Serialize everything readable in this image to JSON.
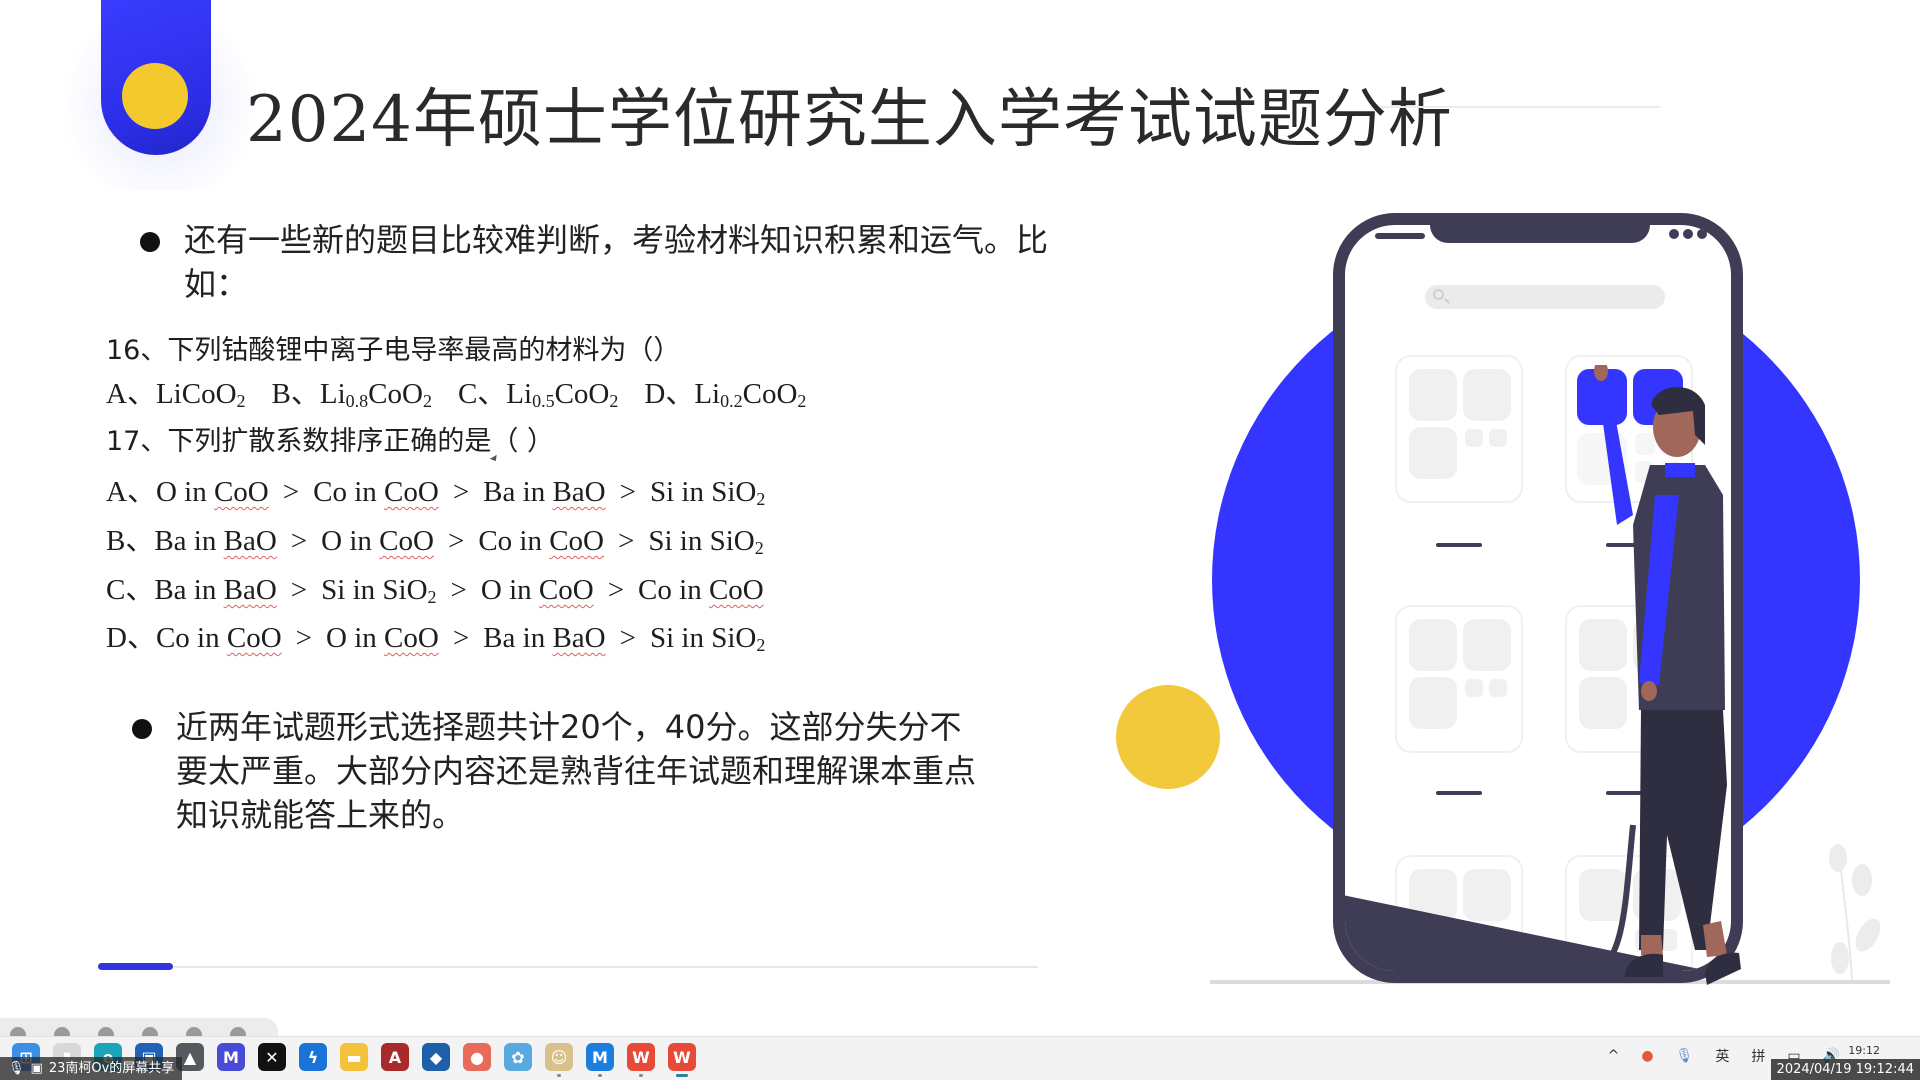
{
  "slide": {
    "title": "2024年硕士学位研究生入学考试试题分析",
    "bullet1": "还有一些新的题目比较难判断，考验材料知识积累和运气。比如：",
    "q16": {
      "stem": "16、下列钴酸锂中离子电导率最高的材料为（）",
      "options": [
        {
          "label": "A、",
          "formula": "LiCoO",
          "sub1": "",
          "mid": "",
          "sub2": "2",
          "pre": "Li",
          "x": ""
        },
        {
          "label": "B、",
          "pre": "Li",
          "x": "0.8",
          "formula": "CoO",
          "sub2": "2"
        },
        {
          "label": "C、",
          "pre": "Li",
          "x": "0.5",
          "formula": "CoO",
          "sub2": "2"
        },
        {
          "label": "D、",
          "pre": "Li",
          "x": "0.2",
          "formula": "CoO",
          "sub2": "2"
        }
      ]
    },
    "q17": {
      "stem": "17、下列扩散系数排序正确的是（ ）",
      "gt": ">",
      "options": [
        {
          "label": "A、",
          "items": [
            [
              "O in ",
              "CoO",
              ""
            ],
            [
              "Co in ",
              "CoO",
              ""
            ],
            [
              "Ba in ",
              "BaO",
              ""
            ],
            [
              "Si in SiO",
              "",
              "2"
            ]
          ]
        },
        {
          "label": "B、",
          "items": [
            [
              "Ba in ",
              "BaO",
              ""
            ],
            [
              "O in ",
              "CoO",
              ""
            ],
            [
              "Co in ",
              "CoO",
              ""
            ],
            [
              "Si in SiO",
              "",
              "2"
            ]
          ]
        },
        {
          "label": "C、",
          "items": [
            [
              "Ba in ",
              "BaO",
              ""
            ],
            [
              "Si in SiO",
              "",
              "2"
            ],
            [
              "O in ",
              "CoO",
              ""
            ],
            [
              "Co in ",
              "CoO",
              ""
            ]
          ]
        },
        {
          "label": "D、",
          "items": [
            [
              "Co in ",
              "CoO",
              ""
            ],
            [
              "O in ",
              "CoO",
              ""
            ],
            [
              "Ba in ",
              "BaO",
              ""
            ],
            [
              "Si in SiO",
              "",
              "2"
            ]
          ]
        }
      ]
    },
    "bullet2": "近两年试题形式选择题共计20个，40分。这部分失分不要太严重。大部分内容还是熟背往年试题和理解课本重点知识就能答上来的。",
    "progress_fraction": 0.08,
    "colors": {
      "accent": "#3436ff",
      "yellow": "#f2c93a",
      "dark": "#3f3d56"
    }
  },
  "meeting": {
    "share_label": "23南柯Ov的屏幕共享"
  },
  "taskbar": {
    "icons": [
      {
        "name": "windows-start-icon",
        "glyph": "⊞",
        "bg": "#3b8fe6"
      },
      {
        "name": "search-icon",
        "glyph": "▮",
        "bg": "#d8d8d8"
      },
      {
        "name": "edge-browser-icon",
        "glyph": "e",
        "bg": "#1aa5b8"
      },
      {
        "name": "microsoft-store-icon",
        "glyph": "▣",
        "bg": "#1f63b6"
      },
      {
        "name": "app-hexagon-icon",
        "glyph": "▲",
        "bg": "#555a60"
      },
      {
        "name": "app-m-icon",
        "glyph": "M",
        "bg": "#4a4ad8"
      },
      {
        "name": "xbox-icon",
        "glyph": "✕",
        "bg": "#111111"
      },
      {
        "name": "app-bolt-icon",
        "glyph": "ϟ",
        "bg": "#1a73d8"
      },
      {
        "name": "file-explorer-icon",
        "glyph": "▬",
        "bg": "#f3c13a"
      },
      {
        "name": "apex-icon",
        "glyph": "A",
        "bg": "#a82a2a"
      },
      {
        "name": "app-shield-icon",
        "glyph": "◆",
        "bg": "#1d5fa8"
      },
      {
        "name": "app-flame-icon",
        "glyph": "●",
        "bg": "#e86a5a"
      },
      {
        "name": "app-gear-icon",
        "glyph": "✿",
        "bg": "#5aa8e0"
      },
      {
        "name": "game-character-icon",
        "glyph": "☺",
        "bg": "#d8c28a"
      },
      {
        "name": "app-cloud-icon",
        "glyph": "M",
        "bg": "#1c7fe0"
      },
      {
        "name": "wps-office-icon",
        "glyph": "W",
        "bg": "#e84a3a"
      },
      {
        "name": "wps-presentation-icon",
        "glyph": "W",
        "bg": "#e84a3a"
      }
    ],
    "tray": {
      "chevron": "^",
      "lang1": "英",
      "lang2": "拼",
      "time": "19:12",
      "timestamp": "2024/04/19 19:12:44"
    }
  }
}
